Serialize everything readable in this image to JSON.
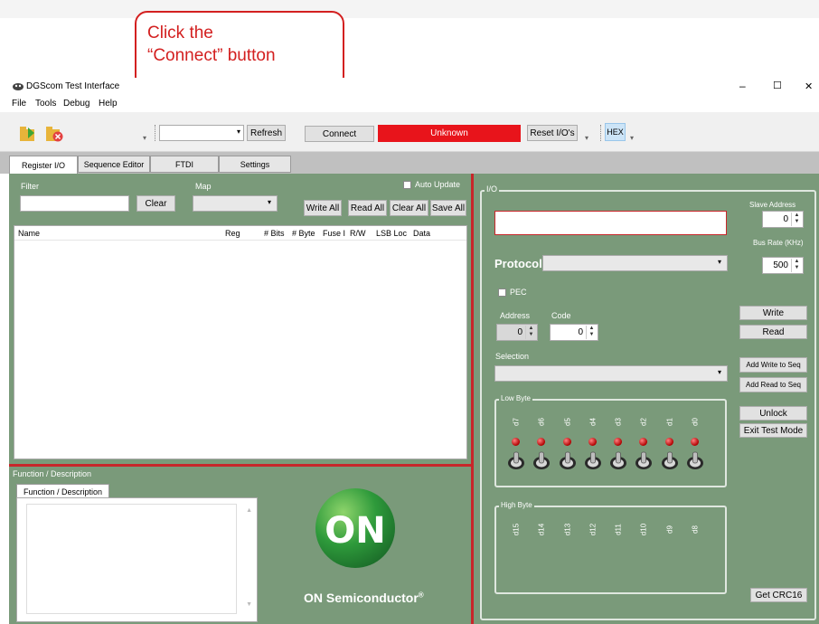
{
  "callout": {
    "line1": "Click the",
    "line2": "“Connect” button"
  },
  "window": {
    "title": "DGScom Test Interface",
    "minimize": "–",
    "maximize": "☐",
    "close": "✕"
  },
  "menu": [
    "File",
    "Tools",
    "Debug",
    "Help"
  ],
  "toolbar": {
    "port_value": "",
    "refresh": "Refresh",
    "connect": "Connect",
    "status": "Unknown",
    "reset": "Reset I/O's",
    "hex": "HEX"
  },
  "tabs": [
    "Register I/O",
    "Sequence Editor",
    "FTDI",
    "Settings"
  ],
  "register": {
    "filter_label": "Filter",
    "map_label": "Map",
    "auto_update": "Auto Update",
    "clear": "Clear",
    "write_all": "Write All",
    "read_all": "Read All",
    "clear_all": "Clear All",
    "save_all": "Save All",
    "columns": [
      "Name",
      "Reg",
      "# Bits",
      "# Byte",
      "Fuse I",
      "R/W",
      "LSB Loc",
      "Data"
    ]
  },
  "function": {
    "section_label": "Function / Description",
    "tab_label": "Function / Description"
  },
  "logo": {
    "mark": "ON",
    "company": "ON Semiconductor",
    "reg": "®"
  },
  "io": {
    "title": "I/O",
    "slave_address_label": "Slave Address",
    "slave_address": "0",
    "bus_rate_label": "Bus Rate (KHz)",
    "bus_rate": "500",
    "protocol_label": "Protocol",
    "pec": "PEC",
    "address_label": "Address",
    "code_label": "Code",
    "address": "0",
    "code": "0",
    "selection_label": "Selection",
    "write": "Write",
    "read": "Read",
    "add_write": "Add Write to Seq",
    "add_read": "Add Read to Seq",
    "unlock": "Unlock",
    "exit_test": "Exit Test Mode",
    "get_crc": "Get CRC16",
    "low_byte_label": "Low Byte",
    "high_byte_label": "High Byte",
    "low_bits": [
      "d7",
      "d6",
      "d5",
      "d4",
      "d3",
      "d2",
      "d1",
      "d0"
    ],
    "high_bits": [
      "d15",
      "d14",
      "d13",
      "d12",
      "d11",
      "d10",
      "d9",
      "d8"
    ]
  },
  "colors": {
    "panel": "#7a9a7a",
    "status_red": "#e8141b",
    "callout_red": "#d32020",
    "divider_red": "#c8262a",
    "logo_green": "#2e9a3b"
  }
}
